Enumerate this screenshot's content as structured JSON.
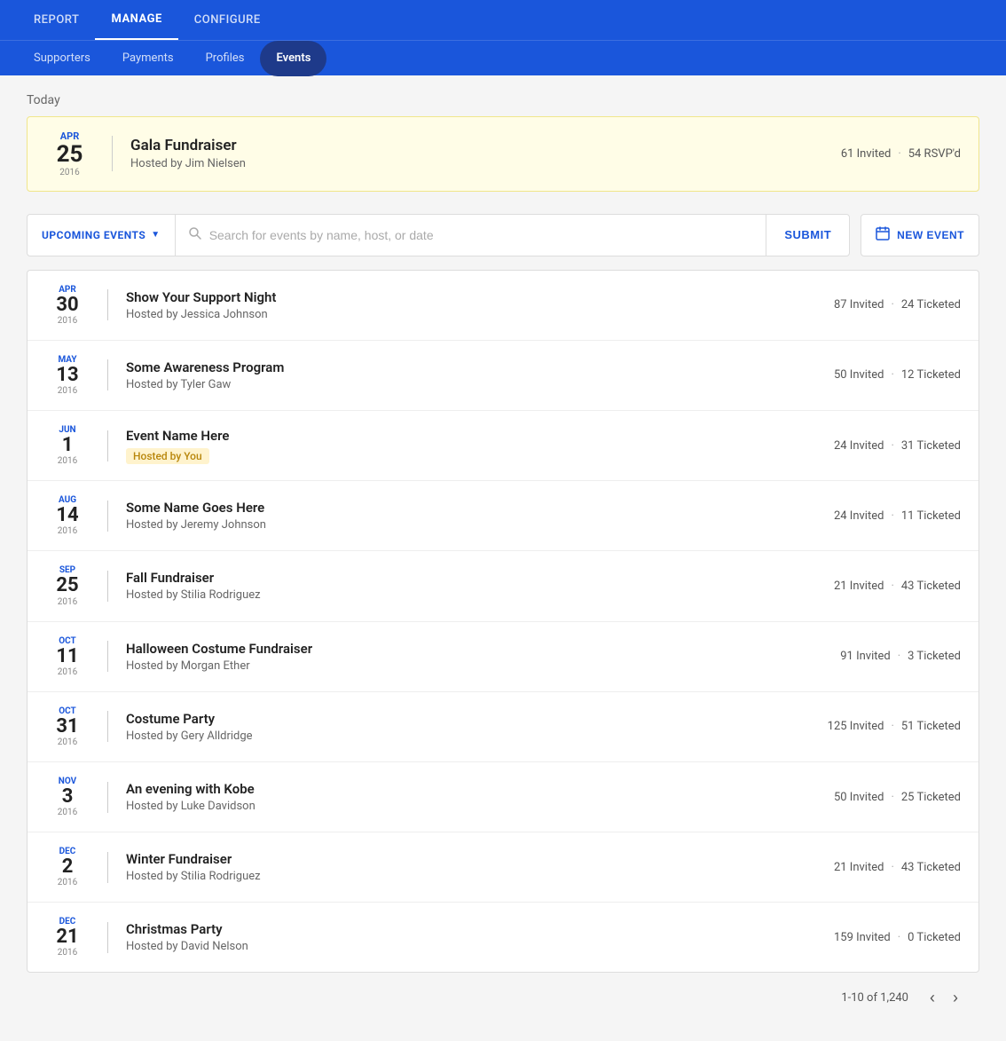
{
  "topNav": {
    "items": [
      {
        "id": "report",
        "label": "REPORT",
        "active": false
      },
      {
        "id": "manage",
        "label": "MANAGE",
        "active": true
      },
      {
        "id": "configure",
        "label": "CONFIGURE",
        "active": false
      }
    ]
  },
  "subNav": {
    "items": [
      {
        "id": "supporters",
        "label": "Supporters",
        "active": false
      },
      {
        "id": "payments",
        "label": "Payments",
        "active": false
      },
      {
        "id": "profiles",
        "label": "Profiles",
        "active": false
      },
      {
        "id": "events",
        "label": "Events",
        "active": true
      }
    ]
  },
  "today": {
    "label": "Today",
    "event": {
      "month": "APR",
      "day": "25",
      "year": "2016",
      "name": "Gala Fundraiser",
      "host": "Hosted by Jim Nielsen",
      "invited": "61 Invited",
      "dot": "·",
      "rsvpd": "54 RSVP'd"
    }
  },
  "filterBar": {
    "dropdown_label": "UPCOMING EVENTS",
    "search_placeholder": "Search for events by name, host, or date",
    "submit_label": "SUBMIT",
    "new_event_label": "NEW EVENT"
  },
  "events": [
    {
      "month": "APR",
      "day": "30",
      "year": "2016",
      "name": "Show Your Support Night",
      "host": "Hosted by Jessica Johnson",
      "invited": "87 Invited",
      "dot": "·",
      "ticketed": "24 Ticketed",
      "hosted_by_you": false
    },
    {
      "month": "MAY",
      "day": "13",
      "year": "2016",
      "name": "Some Awareness Program",
      "host": "Hosted by Tyler Gaw",
      "invited": "50 Invited",
      "dot": "·",
      "ticketed": "12 Ticketed",
      "hosted_by_you": false
    },
    {
      "month": "JUN",
      "day": "1",
      "year": "2016",
      "name": "Event Name Here",
      "host": "Hosted by You",
      "invited": "24 Invited",
      "dot": "·",
      "ticketed": "31 Ticketed",
      "hosted_by_you": true
    },
    {
      "month": "AUG",
      "day": "14",
      "year": "2016",
      "name": "Some Name Goes Here",
      "host": "Hosted by Jeremy Johnson",
      "invited": "24 Invited",
      "dot": "·",
      "ticketed": "11 Ticketed",
      "hosted_by_you": false
    },
    {
      "month": "SEP",
      "day": "25",
      "year": "2016",
      "name": "Fall Fundraiser",
      "host": "Hosted by Stilia Rodriguez",
      "invited": "21 Invited",
      "dot": "·",
      "ticketed": "43 Ticketed",
      "hosted_by_you": false
    },
    {
      "month": "OCT",
      "day": "11",
      "year": "2016",
      "name": "Halloween Costume Fundraiser",
      "host": "Hosted by Morgan Ether",
      "invited": "91 Invited",
      "dot": "·",
      "ticketed": "3 Ticketed",
      "hosted_by_you": false
    },
    {
      "month": "OCT",
      "day": "31",
      "year": "2016",
      "name": "Costume Party",
      "host": "Hosted by Gery Alldridge",
      "invited": "125 Invited",
      "dot": "·",
      "ticketed": "51 Ticketed",
      "hosted_by_you": false
    },
    {
      "month": "NOV",
      "day": "3",
      "year": "2016",
      "name": "An evening with Kobe",
      "host": "Hosted by Luke Davidson",
      "invited": "50 Invited",
      "dot": "·",
      "ticketed": "25 Ticketed",
      "hosted_by_you": false
    },
    {
      "month": "DEC",
      "day": "2",
      "year": "2016",
      "name": "Winter Fundraiser",
      "host": "Hosted by Stilia Rodriguez",
      "invited": "21 Invited",
      "dot": "·",
      "ticketed": "43 Ticketed",
      "hosted_by_you": false
    },
    {
      "month": "DEC",
      "day": "21",
      "year": "2016",
      "name": "Christmas Party",
      "host": "Hosted by David Nelson",
      "invited": "159 Invited",
      "dot": "·",
      "ticketed": "0 Ticketed",
      "hosted_by_you": false
    }
  ],
  "pagination": {
    "info": "1-10 of 1,240"
  }
}
